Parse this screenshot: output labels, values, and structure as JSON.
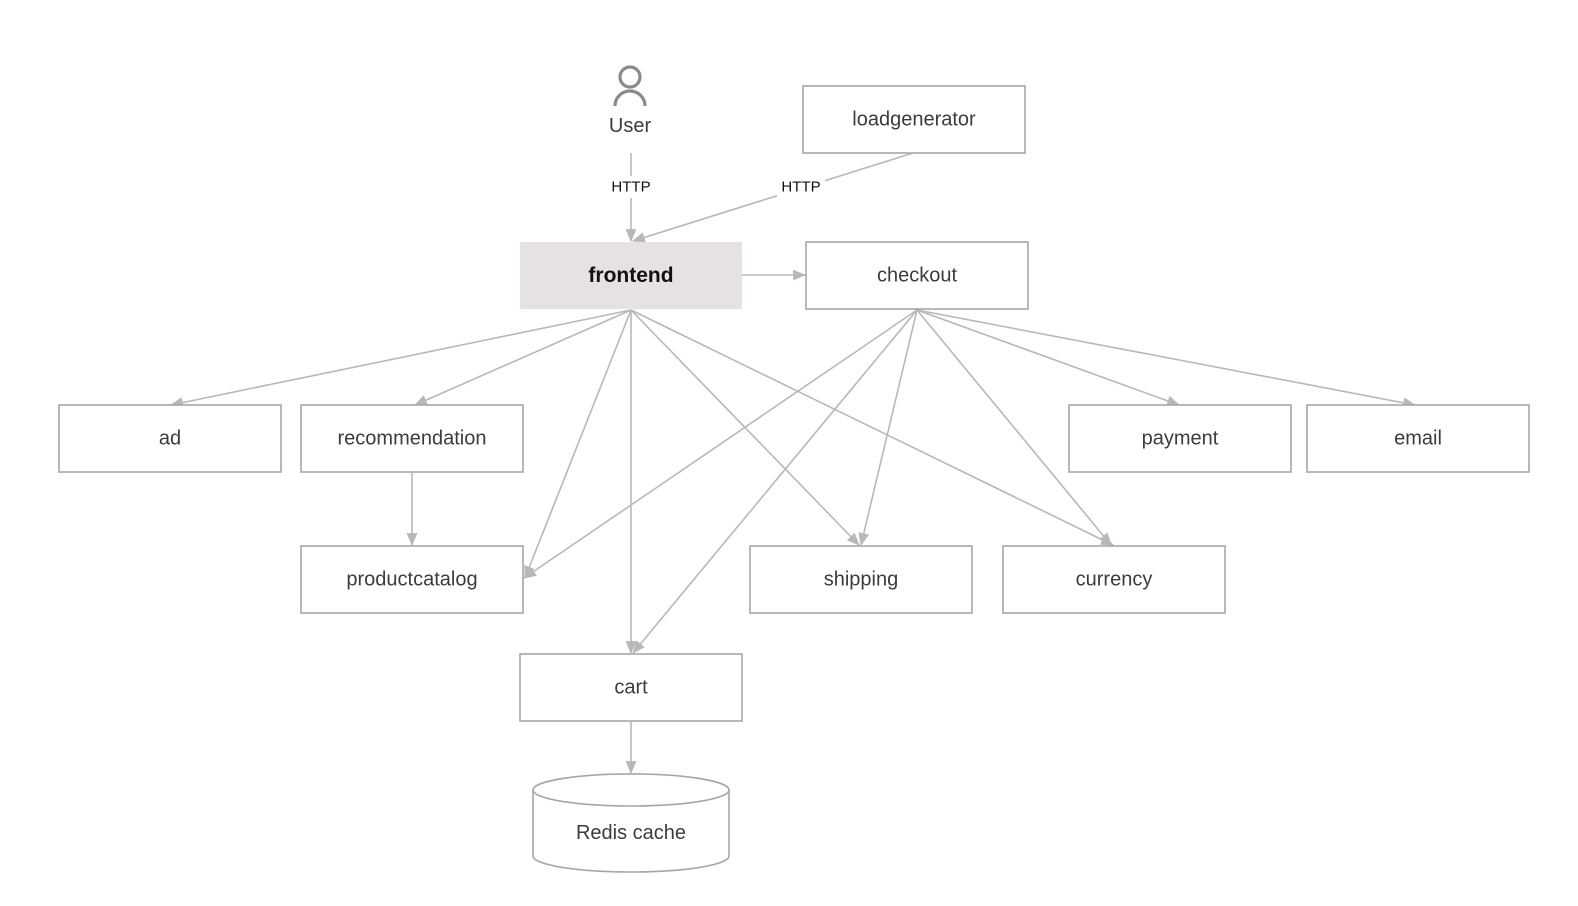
{
  "diagram": {
    "title": "",
    "colors": {
      "highlight_fill": "#e6e1e3",
      "node_border": "#a6a6a6",
      "edge": "#b8b8b8",
      "text": "#3c3c3c"
    },
    "actor": {
      "id": "user",
      "label": "User",
      "icon": "person-icon"
    },
    "nodes": [
      {
        "id": "loadgenerator",
        "label": "loadgenerator",
        "shape": "box"
      },
      {
        "id": "frontend",
        "label": "frontend",
        "shape": "box",
        "highlighted": true
      },
      {
        "id": "checkout",
        "label": "checkout",
        "shape": "box"
      },
      {
        "id": "ad",
        "label": "ad",
        "shape": "box"
      },
      {
        "id": "recommendation",
        "label": "recommendation",
        "shape": "box"
      },
      {
        "id": "payment",
        "label": "payment",
        "shape": "box"
      },
      {
        "id": "email",
        "label": "email",
        "shape": "box"
      },
      {
        "id": "productcatalog",
        "label": "productcatalog",
        "shape": "box"
      },
      {
        "id": "shipping",
        "label": "shipping",
        "shape": "box"
      },
      {
        "id": "currency",
        "label": "currency",
        "shape": "box"
      },
      {
        "id": "cart",
        "label": "cart",
        "shape": "box"
      },
      {
        "id": "redis",
        "label": "Redis cache",
        "shape": "cylinder"
      }
    ],
    "edges": [
      {
        "from": "user",
        "to": "frontend",
        "label": "HTTP"
      },
      {
        "from": "loadgenerator",
        "to": "frontend",
        "label": "HTTP"
      },
      {
        "from": "frontend",
        "to": "checkout"
      },
      {
        "from": "frontend",
        "to": "ad"
      },
      {
        "from": "frontend",
        "to": "recommendation"
      },
      {
        "from": "frontend",
        "to": "productcatalog"
      },
      {
        "from": "frontend",
        "to": "cart"
      },
      {
        "from": "frontend",
        "to": "shipping"
      },
      {
        "from": "frontend",
        "to": "currency"
      },
      {
        "from": "checkout",
        "to": "productcatalog"
      },
      {
        "from": "checkout",
        "to": "cart"
      },
      {
        "from": "checkout",
        "to": "shipping"
      },
      {
        "from": "checkout",
        "to": "currency"
      },
      {
        "from": "checkout",
        "to": "payment"
      },
      {
        "from": "checkout",
        "to": "email"
      },
      {
        "from": "recommendation",
        "to": "productcatalog"
      },
      {
        "from": "cart",
        "to": "redis"
      }
    ]
  }
}
